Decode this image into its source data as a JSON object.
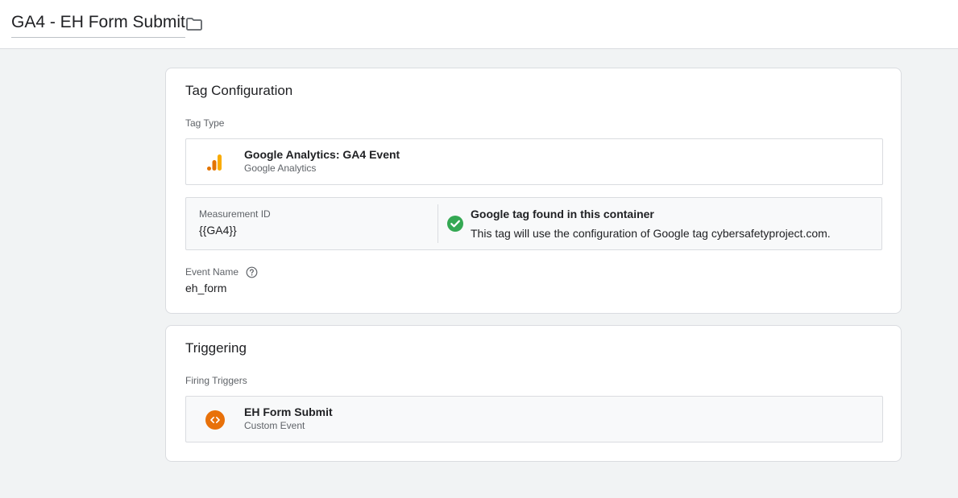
{
  "header": {
    "tag_name": "GA4 - EH Form Submit",
    "folder_icon": "folder-icon"
  },
  "tag_configuration": {
    "title": "Tag Configuration",
    "tag_type_label": "Tag Type",
    "tag_type": {
      "name": "Google Analytics: GA4 Event",
      "provider": "Google Analytics",
      "icon": "google-analytics-icon",
      "icon_colors": [
        "#f9ab00",
        "#e37400"
      ]
    },
    "measurement_id": {
      "label": "Measurement ID",
      "value": "{{GA4}}"
    },
    "google_tag_status": {
      "icon": "check-circle-icon",
      "icon_color": "#34a853",
      "title": "Google tag found in this container",
      "description": "This tag will use the configuration of Google tag cybersafetyproject.com."
    },
    "event_name": {
      "label": "Event Name",
      "help_icon": "help-circle-icon",
      "value": "eh_form"
    }
  },
  "triggering": {
    "title": "Triggering",
    "firing_triggers_label": "Firing Triggers",
    "triggers": [
      {
        "name": "EH Form Submit",
        "type": "Custom Event",
        "icon": "custom-event-icon",
        "icon_color": "#e8710a"
      }
    ]
  }
}
